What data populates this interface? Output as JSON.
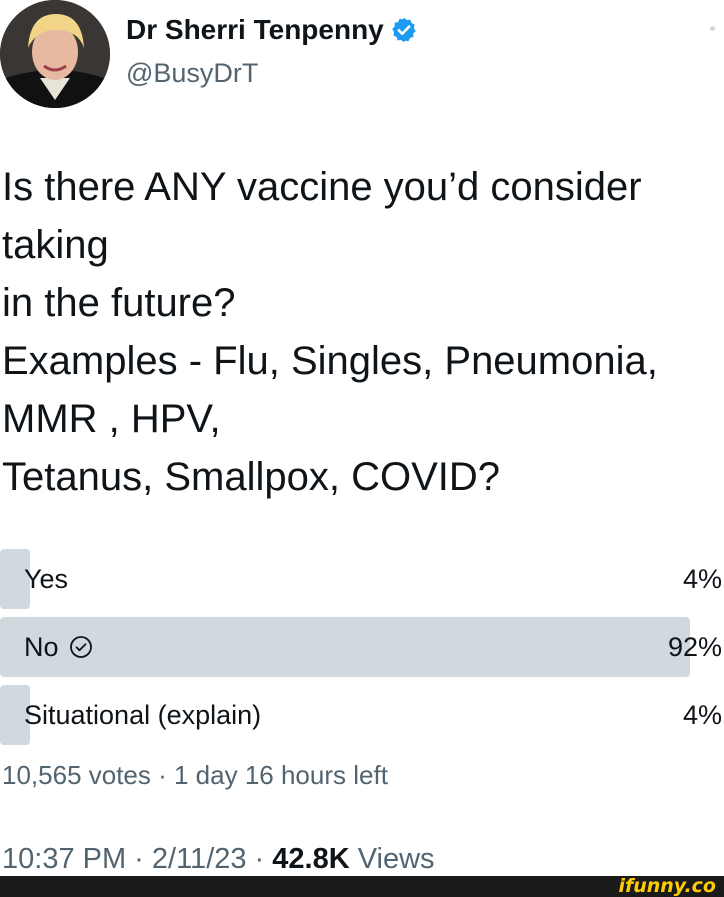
{
  "author": {
    "name": "Dr Sherri Tenpenny",
    "handle": "@BusyDrT",
    "verified": true,
    "verified_color": "#1d9bf0"
  },
  "tweet_text": "Is there ANY vaccine you’d consider taking\nin the future?\nExamples - Flu, Singles, Pneumonia, MMR , HPV,\nTetanus, Smallpox, COVID?",
  "poll": {
    "options": [
      {
        "label": "Yes",
        "percent_text": "4%",
        "percent": 4,
        "selected": false
      },
      {
        "label": "No",
        "percent_text": "92%",
        "percent": 92,
        "selected": true
      },
      {
        "label": "Situational (explain)",
        "percent_text": "4%",
        "percent": 4,
        "selected": false
      }
    ],
    "meta": "10,565 votes · 1 day 16 hours left"
  },
  "timestamp": {
    "time_date": "10:37 PM · 2/11/23 · ",
    "views_count": "42.8K",
    "views_label": " Views"
  },
  "watermark": "ifunny.co",
  "colors": {
    "bar": "#cfd9de",
    "muted_text": "#536471",
    "text": "#0f1419",
    "watermark": "#ffcc00"
  }
}
